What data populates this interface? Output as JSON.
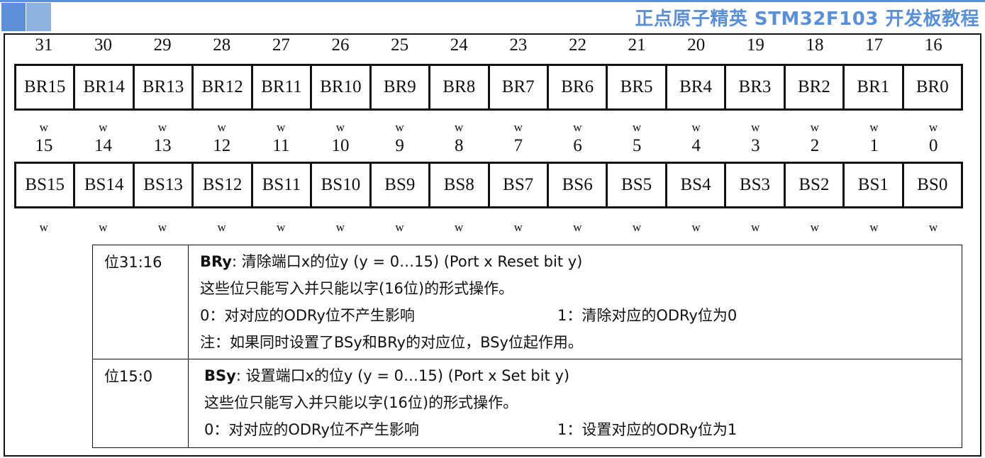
{
  "header": {
    "title": "正点原子精英 STM32F103 开发板教程",
    "accent": "#5b8fd6"
  },
  "high": {
    "bits": [
      "31",
      "30",
      "29",
      "28",
      "27",
      "26",
      "25",
      "24",
      "23",
      "22",
      "21",
      "20",
      "19",
      "18",
      "17",
      "16"
    ],
    "fields": [
      "BR15",
      "BR14",
      "BR13",
      "BR12",
      "BR11",
      "BR10",
      "BR9",
      "BR8",
      "BR7",
      "BR6",
      "BR5",
      "BR4",
      "BR3",
      "BR2",
      "BR1",
      "BR0"
    ],
    "access": "w"
  },
  "low": {
    "bits": [
      "15",
      "14",
      "13",
      "12",
      "11",
      "10",
      "9",
      "8",
      "7",
      "6",
      "5",
      "4",
      "3",
      "2",
      "1",
      "0"
    ],
    "fields": [
      "BS15",
      "BS14",
      "BS13",
      "BS12",
      "BS11",
      "BS10",
      "BS9",
      "BS8",
      "BS7",
      "BS6",
      "BS5",
      "BS4",
      "BS3",
      "BS2",
      "BS1",
      "BS0"
    ],
    "access": "w"
  },
  "desc": [
    {
      "bits": "位31:16",
      "name": "BRy",
      "title": ": 清除端口x的位y (y = 0…15) (Port x Reset bit y)",
      "line1": "这些位只能写入并只能以字(16位)的形式操作。",
      "opt0": "0：对对应的ODRy位不产生影响",
      "opt1": "1：清除对应的ODRy位为0",
      "note": "注：如果同时设置了BSy和BRy的对应位，BSy位起作用。"
    },
    {
      "bits": "位15:0",
      "name": "BSy",
      "title": ": 设置端口x的位y (y = 0…15) (Port x Set bit y)",
      "line1": "这些位只能写入并只能以字(16位)的形式操作。",
      "opt0": "0：对对应的ODRy位不产生影响",
      "opt1": "1：设置对应的ODRy位为1"
    }
  ]
}
